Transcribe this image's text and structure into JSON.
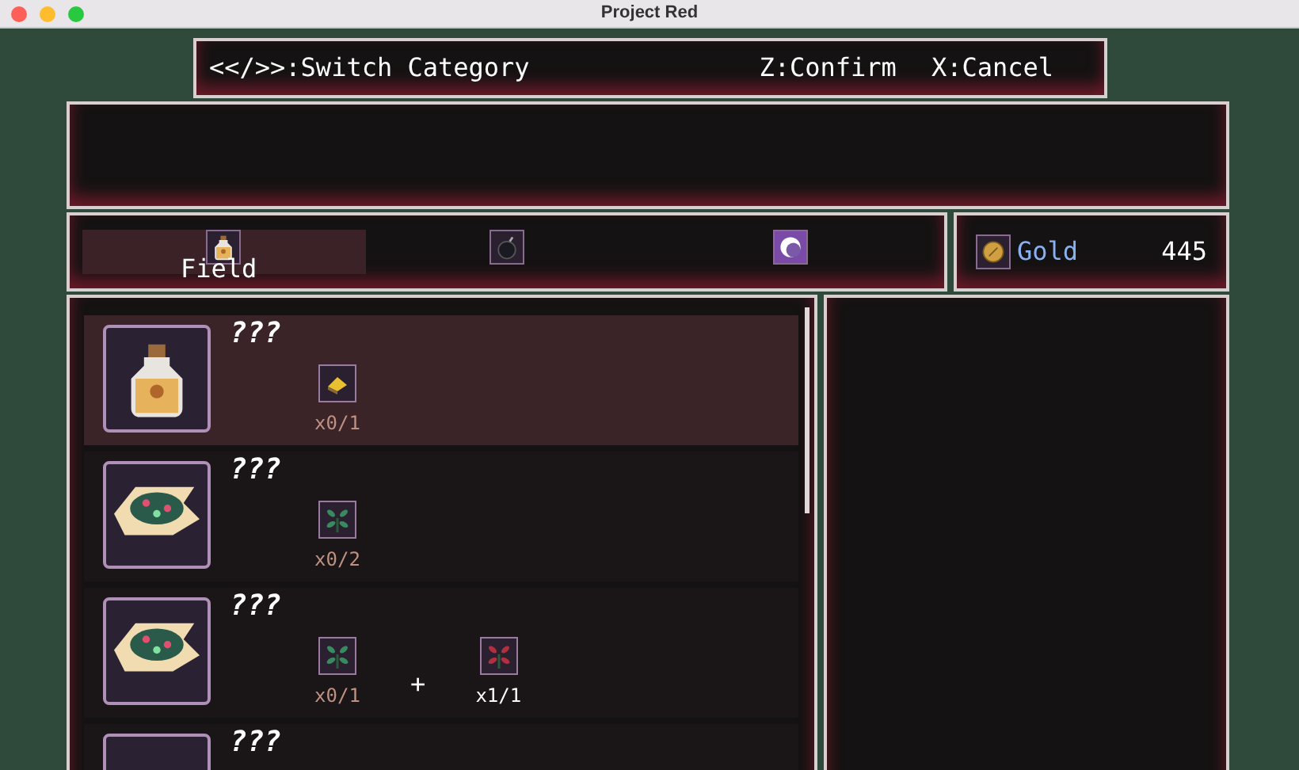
{
  "window": {
    "title": "Project Red"
  },
  "help_bar": {
    "switch": "<</>>:Switch Category",
    "confirm": "Z:Confirm",
    "cancel": "X:Cancel"
  },
  "tabs": [
    {
      "kind": "potion",
      "label": "Field",
      "selected": true
    },
    {
      "kind": "bomb",
      "selected": false
    },
    {
      "kind": "orb",
      "selected": false
    }
  ],
  "currency": {
    "label": "Gold",
    "amount": "445"
  },
  "recipes": [
    {
      "kind": "potion",
      "name": "???",
      "selected": true,
      "ingredients": [
        {
          "kind": "ore",
          "count": "x0/1",
          "enough": false
        }
      ]
    },
    {
      "kind": "herbs",
      "name": "???",
      "selected": false,
      "ingredients": [
        {
          "kind": "green-leaf",
          "count": "x0/2",
          "enough": false
        }
      ]
    },
    {
      "kind": "herbs",
      "name": "???",
      "selected": false,
      "ingredients": [
        {
          "kind": "green-leaf",
          "count": "x0/1",
          "enough": false
        },
        {
          "kind": "red-leaf",
          "count": "x1/1",
          "enough": true
        }
      ],
      "joiner": "+"
    },
    {
      "kind": "blank",
      "name": "???",
      "selected": false
    }
  ]
}
